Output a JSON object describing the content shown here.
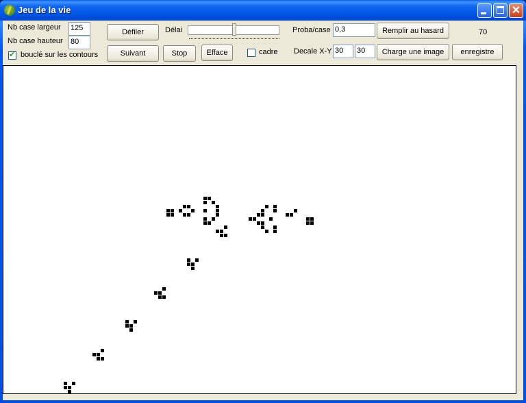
{
  "window": {
    "title": "Jeu de la vie",
    "controls": [
      "minimize",
      "maximize",
      "close"
    ]
  },
  "settings": {
    "width_label": "Nb case largeur",
    "width_value": "125",
    "height_label": "Nb case hauteur",
    "height_value": "80",
    "wrap_label": "bouclé sur les contours",
    "wrap_checked": true
  },
  "buttons": {
    "scroll": "Défiler",
    "next": "Suivant",
    "stop": "Stop",
    "clear": "Efface",
    "random_fill": "Remplir au hasard",
    "load_image": "Charge une image",
    "save": "enregistre"
  },
  "delay": {
    "label": "Délai",
    "position": 0.51
  },
  "frame": {
    "label": "cadre",
    "checked": false
  },
  "probability": {
    "label": "Proba/case",
    "value": "0,3"
  },
  "offset": {
    "label": "Decale X-Y",
    "x": "30",
    "y": "30"
  },
  "generation_counter": "70",
  "grid": {
    "cols": 125,
    "rows": 80,
    "live_cells": [
      [
        40,
        35
      ],
      [
        41,
        35
      ],
      [
        40,
        36
      ],
      [
        41,
        36
      ],
      [
        44,
        34
      ],
      [
        45,
        34
      ],
      [
        43,
        35
      ],
      [
        46,
        35
      ],
      [
        44,
        36
      ],
      [
        45,
        36
      ],
      [
        49,
        32
      ],
      [
        50,
        32
      ],
      [
        49,
        33
      ],
      [
        51,
        33
      ],
      [
        52,
        34
      ],
      [
        49,
        35
      ],
      [
        52,
        35
      ],
      [
        52,
        36
      ],
      [
        49,
        37
      ],
      [
        51,
        37
      ],
      [
        49,
        38
      ],
      [
        50,
        38
      ],
      [
        54,
        39
      ],
      [
        52,
        40
      ],
      [
        53,
        40
      ],
      [
        53,
        41
      ],
      [
        54,
        41
      ],
      [
        64,
        34
      ],
      [
        66,
        34
      ],
      [
        63,
        35
      ],
      [
        66,
        35
      ],
      [
        62,
        36
      ],
      [
        63,
        36
      ],
      [
        60,
        37
      ],
      [
        61,
        37
      ],
      [
        65,
        37
      ],
      [
        62,
        38
      ],
      [
        63,
        38
      ],
      [
        63,
        39
      ],
      [
        66,
        39
      ],
      [
        64,
        40
      ],
      [
        66,
        40
      ],
      [
        71,
        35
      ],
      [
        69,
        36
      ],
      [
        70,
        36
      ],
      [
        74,
        37
      ],
      [
        75,
        37
      ],
      [
        74,
        38
      ],
      [
        75,
        38
      ],
      [
        45,
        47
      ],
      [
        47,
        47
      ],
      [
        45,
        48
      ],
      [
        46,
        48
      ],
      [
        46,
        49
      ],
      [
        39,
        54
      ],
      [
        37,
        55
      ],
      [
        38,
        55
      ],
      [
        38,
        56
      ],
      [
        39,
        56
      ],
      [
        30,
        62
      ],
      [
        32,
        62
      ],
      [
        30,
        63
      ],
      [
        31,
        63
      ],
      [
        31,
        64
      ],
      [
        24,
        69
      ],
      [
        22,
        70
      ],
      [
        23,
        70
      ],
      [
        23,
        71
      ],
      [
        24,
        71
      ],
      [
        15,
        77
      ],
      [
        17,
        77
      ],
      [
        15,
        78
      ],
      [
        16,
        78
      ],
      [
        16,
        79
      ]
    ]
  }
}
